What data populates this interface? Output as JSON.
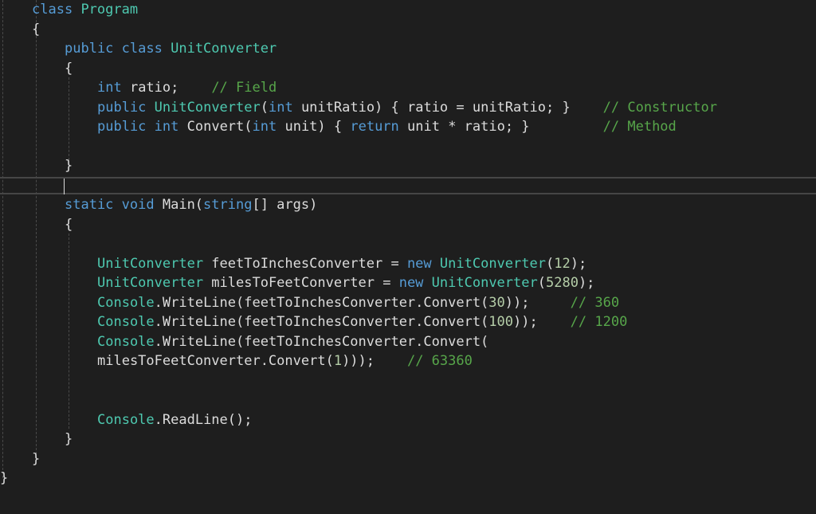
{
  "editor": {
    "colors": {
      "background": "#1e1e1e",
      "keyword": "#569cd6",
      "type": "#4ec9b0",
      "comment": "#57a64a",
      "number": "#b5cea8",
      "plain": "#dcdcdc"
    },
    "lines": [
      {
        "indent": 1,
        "tokens": [
          {
            "t": "kw",
            "v": "class"
          },
          {
            "t": "pl",
            "v": " "
          },
          {
            "t": "ty",
            "v": "Program"
          }
        ]
      },
      {
        "indent": 1,
        "tokens": [
          {
            "t": "pl",
            "v": "{"
          }
        ]
      },
      {
        "indent": 2,
        "tokens": [
          {
            "t": "kw",
            "v": "public"
          },
          {
            "t": "pl",
            "v": " "
          },
          {
            "t": "kw",
            "v": "class"
          },
          {
            "t": "pl",
            "v": " "
          },
          {
            "t": "ty",
            "v": "UnitConverter"
          }
        ]
      },
      {
        "indent": 2,
        "tokens": [
          {
            "t": "pl",
            "v": "{"
          }
        ]
      },
      {
        "indent": 3,
        "tokens": [
          {
            "t": "kw",
            "v": "int"
          },
          {
            "t": "pl",
            "v": " ratio;    "
          },
          {
            "t": "cm",
            "v": "// Field"
          }
        ]
      },
      {
        "indent": 3,
        "tokens": [
          {
            "t": "kw",
            "v": "public"
          },
          {
            "t": "pl",
            "v": " "
          },
          {
            "t": "ty",
            "v": "UnitConverter"
          },
          {
            "t": "pl",
            "v": "("
          },
          {
            "t": "kw",
            "v": "int"
          },
          {
            "t": "pl",
            "v": " unitRatio) { ratio = unitRatio; }    "
          },
          {
            "t": "cm",
            "v": "// Constructor"
          }
        ]
      },
      {
        "indent": 3,
        "tokens": [
          {
            "t": "kw",
            "v": "public"
          },
          {
            "t": "pl",
            "v": " "
          },
          {
            "t": "kw",
            "v": "int"
          },
          {
            "t": "pl",
            "v": " Convert("
          },
          {
            "t": "kw",
            "v": "int"
          },
          {
            "t": "pl",
            "v": " unit) { "
          },
          {
            "t": "kw",
            "v": "return"
          },
          {
            "t": "pl",
            "v": " unit * ratio; }         "
          },
          {
            "t": "cm",
            "v": "// Method"
          }
        ]
      },
      {
        "indent": 3,
        "tokens": []
      },
      {
        "indent": 2,
        "tokens": [
          {
            "t": "pl",
            "v": "}"
          }
        ]
      },
      {
        "indent": 2,
        "tokens": [],
        "caret": true
      },
      {
        "indent": 2,
        "tokens": [
          {
            "t": "kw",
            "v": "static"
          },
          {
            "t": "pl",
            "v": " "
          },
          {
            "t": "kw",
            "v": "void"
          },
          {
            "t": "pl",
            "v": " Main("
          },
          {
            "t": "kw",
            "v": "string"
          },
          {
            "t": "pl",
            "v": "[] args)"
          }
        ]
      },
      {
        "indent": 2,
        "tokens": [
          {
            "t": "pl",
            "v": "{"
          }
        ]
      },
      {
        "indent": 3,
        "tokens": []
      },
      {
        "indent": 3,
        "tokens": [
          {
            "t": "ty",
            "v": "UnitConverter"
          },
          {
            "t": "pl",
            "v": " feetToInchesConverter = "
          },
          {
            "t": "kw",
            "v": "new"
          },
          {
            "t": "pl",
            "v": " "
          },
          {
            "t": "ty",
            "v": "UnitConverter"
          },
          {
            "t": "pl",
            "v": "("
          },
          {
            "t": "nm",
            "v": "12"
          },
          {
            "t": "pl",
            "v": ");"
          }
        ]
      },
      {
        "indent": 3,
        "tokens": [
          {
            "t": "ty",
            "v": "UnitConverter"
          },
          {
            "t": "pl",
            "v": " milesToFeetConverter = "
          },
          {
            "t": "kw",
            "v": "new"
          },
          {
            "t": "pl",
            "v": " "
          },
          {
            "t": "ty",
            "v": "UnitConverter"
          },
          {
            "t": "pl",
            "v": "("
          },
          {
            "t": "nm",
            "v": "5280"
          },
          {
            "t": "pl",
            "v": ");"
          }
        ]
      },
      {
        "indent": 3,
        "tokens": [
          {
            "t": "ty",
            "v": "Console"
          },
          {
            "t": "pl",
            "v": ".WriteLine(feetToInchesConverter.Convert("
          },
          {
            "t": "nm",
            "v": "30"
          },
          {
            "t": "pl",
            "v": "));     "
          },
          {
            "t": "cm",
            "v": "// 360"
          }
        ]
      },
      {
        "indent": 3,
        "tokens": [
          {
            "t": "ty",
            "v": "Console"
          },
          {
            "t": "pl",
            "v": ".WriteLine(feetToInchesConverter.Convert("
          },
          {
            "t": "nm",
            "v": "100"
          },
          {
            "t": "pl",
            "v": "));    "
          },
          {
            "t": "cm",
            "v": "// 1200"
          }
        ]
      },
      {
        "indent": 3,
        "tokens": [
          {
            "t": "ty",
            "v": "Console"
          },
          {
            "t": "pl",
            "v": ".WriteLine(feetToInchesConverter.Convert("
          }
        ]
      },
      {
        "indent": 3,
        "tokens": [
          {
            "t": "pl",
            "v": "milesToFeetConverter.Convert("
          },
          {
            "t": "nm",
            "v": "1"
          },
          {
            "t": "pl",
            "v": ")));    "
          },
          {
            "t": "cm",
            "v": "// 63360"
          }
        ]
      },
      {
        "indent": 3,
        "tokens": []
      },
      {
        "indent": 3,
        "tokens": []
      },
      {
        "indent": 3,
        "tokens": [
          {
            "t": "ty",
            "v": "Console"
          },
          {
            "t": "pl",
            "v": ".ReadLine();"
          }
        ]
      },
      {
        "indent": 2,
        "tokens": [
          {
            "t": "pl",
            "v": "}"
          }
        ]
      },
      {
        "indent": 1,
        "tokens": [
          {
            "t": "pl",
            "v": "}"
          }
        ]
      },
      {
        "indent": 0,
        "tokens": [
          {
            "t": "pl",
            "v": "}"
          }
        ]
      }
    ]
  }
}
